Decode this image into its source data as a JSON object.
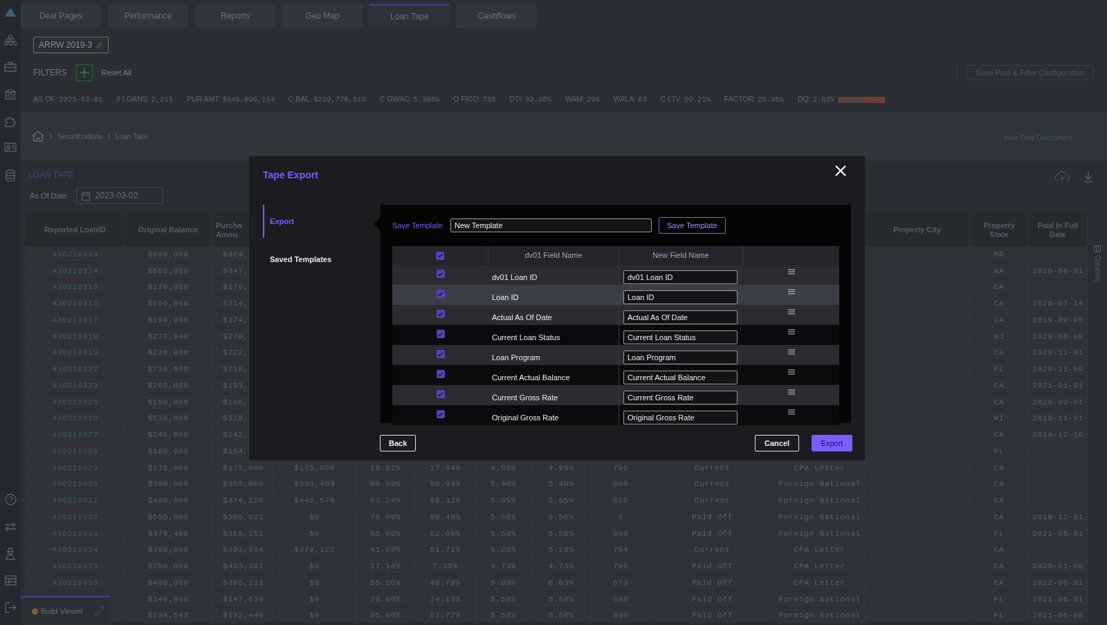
{
  "tabs": [
    {
      "label": "Deal Pages",
      "selected": false
    },
    {
      "label": "Performance",
      "selected": false
    },
    {
      "label": "Reports",
      "selected": false
    },
    {
      "label": "Geo Map",
      "selected": false
    },
    {
      "label": "Loan Tape",
      "selected": true
    },
    {
      "label": "Cashflows",
      "selected": false
    }
  ],
  "deal": {
    "name": "ARRW 2019-3"
  },
  "filters": {
    "label": "FILTERS",
    "reset": "Reset All",
    "save_button": "Save Pool & Filter Configuration"
  },
  "stats": [
    {
      "label": "AS OF:",
      "value": "2023-02-01"
    },
    {
      "label": "# LOANS:",
      "value": "2,215"
    },
    {
      "label": "PUR AMT:",
      "value": "$945,896,114"
    },
    {
      "label": "C BAL:",
      "value": "$239,778,519"
    },
    {
      "label": "C GWAC:",
      "value": "5.386%"
    },
    {
      "label": "O FICO:",
      "value": "735"
    },
    {
      "label": "DTI:",
      "value": "33.35%"
    },
    {
      "label": "WAM:",
      "value": "295"
    },
    {
      "label": "WALA:",
      "value": "63"
    },
    {
      "label": "C LTV:",
      "value": "60.21%"
    },
    {
      "label": "FACTOR:",
      "value": "25.35%"
    },
    {
      "label": "DQ:",
      "value": "2.83%"
    }
  ],
  "breadcrumb": [
    "Securitizations",
    "Loan Tape"
  ],
  "disclaimer_link": "View Deal Disclaimers",
  "loan_tape": {
    "title": "LOAN TAPE",
    "as_of_label": "As Of Date",
    "as_of_value": "2023-03-02",
    "columns_tab": "Columns",
    "columns": [
      "Reported LoanID",
      "Original Balance",
      "Purcha Amou",
      "Property City",
      "Property State",
      "Paid In Full Date"
    ],
    "rows": [
      {
        "loan_id": "430219313",
        "original_balance": "$999,000",
        "purchase_amount": "$984,",
        "property_state": "MD"
      },
      {
        "loan_id": "430219314",
        "original_balance": "$600,000",
        "purchase_amount": "$347,",
        "property_state": "WA",
        "paid_in_full_date": "2020-08-01"
      },
      {
        "loan_id": "430219315",
        "original_balance": "$176,000",
        "purchase_amount": "$170,",
        "property_state": "CA"
      },
      {
        "loan_id": "430219316",
        "original_balance": "$950,000",
        "purchase_amount": "$314,",
        "property_state": "CA",
        "paid_in_full_date": "2020-07-14"
      },
      {
        "loan_id": "430219317",
        "original_balance": "$180,000",
        "purchase_amount": "$174,",
        "property_state": "CA",
        "paid_in_full_date": "2019-09-05"
      },
      {
        "loan_id": "430219318",
        "original_balance": "$277,940",
        "purchase_amount": "$270,",
        "property_state": "NJ",
        "paid_in_full_date": "2020-06-08"
      },
      {
        "loan_id": "430219319",
        "original_balance": "$230,000",
        "purchase_amount": "$222,",
        "property_state": "CA",
        "paid_in_full_date": "2020-11-01"
      },
      {
        "loan_id": "430219322",
        "original_balance": "$738,500",
        "purchase_amount": "$718,",
        "property_state": "FL",
        "paid_in_full_date": "2020-11-09"
      },
      {
        "loan_id": "430219323",
        "original_balance": "$200,000",
        "purchase_amount": "$193,",
        "property_state": "CA",
        "paid_in_full_date": "2021-01-01"
      },
      {
        "loan_id": "430219325",
        "original_balance": "$150,000",
        "purchase_amount": "$106,",
        "property_state": "CA",
        "paid_in_full_date": "2020-09-01"
      },
      {
        "loan_id": "430219326",
        "original_balance": "$536,000",
        "purchase_amount": "$528,",
        "property_state": "HI",
        "paid_in_full_date": "2019-11-01"
      },
      {
        "loan_id": "430219327",
        "original_balance": "$246,000",
        "purchase_amount": "$242,",
        "property_state": "CA",
        "paid_in_full_date": "2019-12-16"
      },
      {
        "loan_id": "430219328",
        "original_balance": "$166,600",
        "purchase_amount": "$164,",
        "property_state": "FL"
      },
      {
        "loan_id": "430219329",
        "original_balance": "$175,000",
        "purchase_amount": "$175,000",
        "column_4": "$175,000",
        "column_5": "18.92%",
        "column_6": "17.04%",
        "column_7": "4.95%",
        "column_8": "4.95%",
        "column_9": "796",
        "column_10": "Current",
        "column_11": "CPA Letter",
        "property_state": "CA"
      },
      {
        "loan_id": "430219330",
        "original_balance": "$360,000",
        "purchase_amount": "$355,060",
        "column_4": "$333,463",
        "column_5": "60.00%",
        "column_6": "56.99%",
        "column_7": "5.40%",
        "column_8": "5.40%",
        "column_9": "800",
        "column_10": "Current",
        "column_11": "Foreign National",
        "property_state": "CA"
      },
      {
        "loan_id": "430219331",
        "original_balance": "$480,600",
        "purchase_amount": "$474,126",
        "column_4": "$446,576",
        "column_5": "63.24%",
        "column_6": "58.32%",
        "column_7": "5.95%",
        "column_8": "5.95%",
        "column_9": "626",
        "column_10": "Current",
        "column_11": "Foreign National",
        "property_state": "CA"
      },
      {
        "loan_id": "430219332",
        "original_balance": "$595,000",
        "purchase_amount": "$585,021",
        "column_4": "$0",
        "column_5": "70.00%",
        "column_6": "69.48%",
        "column_7": "5.58%",
        "column_8": "5.58%",
        "column_9": "0",
        "column_10": "Paid Off",
        "column_11": "Foreign National",
        "property_state": "CA",
        "paid_in_full_date": "2019-12-01"
      },
      {
        "loan_id": "430219333",
        "original_balance": "$370,496",
        "purchase_amount": "$365,151",
        "column_4": "$0",
        "column_5": "65.00%",
        "column_6": "62.00%",
        "column_7": "5.58%",
        "column_8": "5.58%",
        "column_9": "800",
        "column_10": "Paid Off",
        "column_11": "Foreign National",
        "property_state": "FL",
        "paid_in_full_date": "2021-05-01"
      },
      {
        "loan_id": "430219334",
        "original_balance": "$398,000",
        "purchase_amount": "$391,934",
        "column_4": "$379,122",
        "column_5": "41.89%",
        "column_6": "51.71%",
        "column_7": "5.28%",
        "column_8": "5.28%",
        "column_9": "704",
        "column_10": "Current",
        "column_11": "CPA Letter",
        "property_state": "CA"
      },
      {
        "loan_id": "430219335",
        "original_balance": "$750,000",
        "purchase_amount": "$453,301",
        "column_4": "$0",
        "column_5": "17.14%",
        "column_6": "7.35%",
        "column_7": "4.73%",
        "column_8": "4.73%",
        "column_9": "796",
        "column_10": "Paid Off",
        "column_11": "CPA Letter",
        "property_state": "CA",
        "paid_in_full_date": "2020-01-08"
      },
      {
        "loan_id": "430219336",
        "original_balance": "$400,000",
        "purchase_amount": "$395,111",
        "column_4": "$0",
        "column_5": "55.25%",
        "column_6": "48.78%",
        "column_7": "6.03%",
        "column_8": "6.03%",
        "column_9": "673",
        "column_10": "Paid Off",
        "column_11": "CPA Letter",
        "property_state": "CA",
        "paid_in_full_date": "2022-06-01"
      },
      {
        "original_balance": "$149,800",
        "purchase_amount": "$147,639",
        "column_4": "$0",
        "column_5": "70.00%",
        "column_6": "74.19%",
        "column_7": "5.58%",
        "column_8": "5.58%",
        "column_9": "680",
        "column_10": "Paid Off",
        "column_11": "Foreign National",
        "property_state": "FL",
        "paid_in_full_date": "2021-08-01"
      },
      {
        "original_balance": "$134,543",
        "purchase_amount": "$132,448",
        "column_4": "$0",
        "column_5": "65.00%",
        "column_6": "62.77%",
        "column_7": "5.58%",
        "column_8": "5.58%",
        "column_9": "800",
        "column_10": "Paid Off",
        "column_11": "Foreign National",
        "property_state": "FL",
        "paid_in_full_date": "2021-06-08"
      }
    ]
  },
  "build_viewer": {
    "label": "Build Viewer"
  },
  "modal": {
    "title": "Tape Export",
    "nav": [
      {
        "label": "Export",
        "selected": true
      },
      {
        "label": "Saved Templates",
        "selected": false
      }
    ],
    "save_label": "Save Template",
    "template_name": "New Template",
    "save_button": "Save Template",
    "select_all": {
      "checked": true
    },
    "columns": [
      "dv01 Field Name",
      "New Field Name"
    ],
    "fields": [
      {
        "checked": true,
        "highlighted": false,
        "field": "dv01 Loan ID",
        "new_name": "dv01 Loan ID"
      },
      {
        "checked": true,
        "highlighted": true,
        "field": "Loan ID",
        "new_name": "Loan ID"
      },
      {
        "checked": true,
        "highlighted": false,
        "field": "Actual As Of Date",
        "new_name": "Actual As Of Date"
      },
      {
        "checked": true,
        "highlighted": false,
        "field": "Current Loan Status",
        "new_name": "Current Loan Status"
      },
      {
        "checked": true,
        "highlighted": false,
        "field": "Loan Program",
        "new_name": "Loan Program"
      },
      {
        "checked": true,
        "highlighted": false,
        "field": "Current Actual Balance",
        "new_name": "Current Actual Balance"
      },
      {
        "checked": true,
        "highlighted": false,
        "field": "Current Gross Rate",
        "new_name": "Current Gross Rate"
      },
      {
        "checked": true,
        "highlighted": false,
        "field": "Original Gross Rate",
        "new_name": "Original Gross Rate"
      }
    ],
    "back": "Back",
    "cancel": "Cancel",
    "export": "Export"
  }
}
